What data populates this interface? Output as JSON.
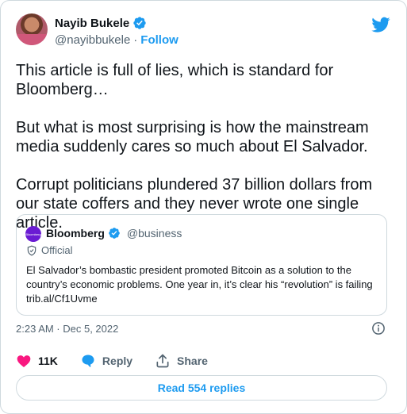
{
  "author": {
    "name": "Nayib Bukele",
    "handle": "@nayibbukele",
    "separator": "·",
    "follow_label": "Follow"
  },
  "tweet": {
    "paragraphs": [
      "This article is full of lies, which is standard for Bloomberg…",
      "But what is most surprising is how the mainstream media suddenly cares so much about El Salvador.",
      "Corrupt politicians plundered 37 billion dollars from our state coffers and they never wrote one single article."
    ]
  },
  "quote": {
    "name": "Bloomberg",
    "handle": "@business",
    "avatar_text": "Bloomberg",
    "official_label": "Official",
    "text": "El Salvador’s bombastic president promoted Bitcoin as a solution to the country’s economic problems. One year in, it’s clear his “revolution” is failing trib.al/Cf1Uvme"
  },
  "meta": {
    "timestamp": "2:23 AM · Dec 5, 2022"
  },
  "actions": {
    "like_count": "11K",
    "reply_label": "Reply",
    "share_label": "Share"
  },
  "replies_button": "Read 554 replies",
  "colors": {
    "accent": "#1d9bf0",
    "like": "#f91880",
    "text": "#0f1419",
    "muted": "#536471"
  }
}
